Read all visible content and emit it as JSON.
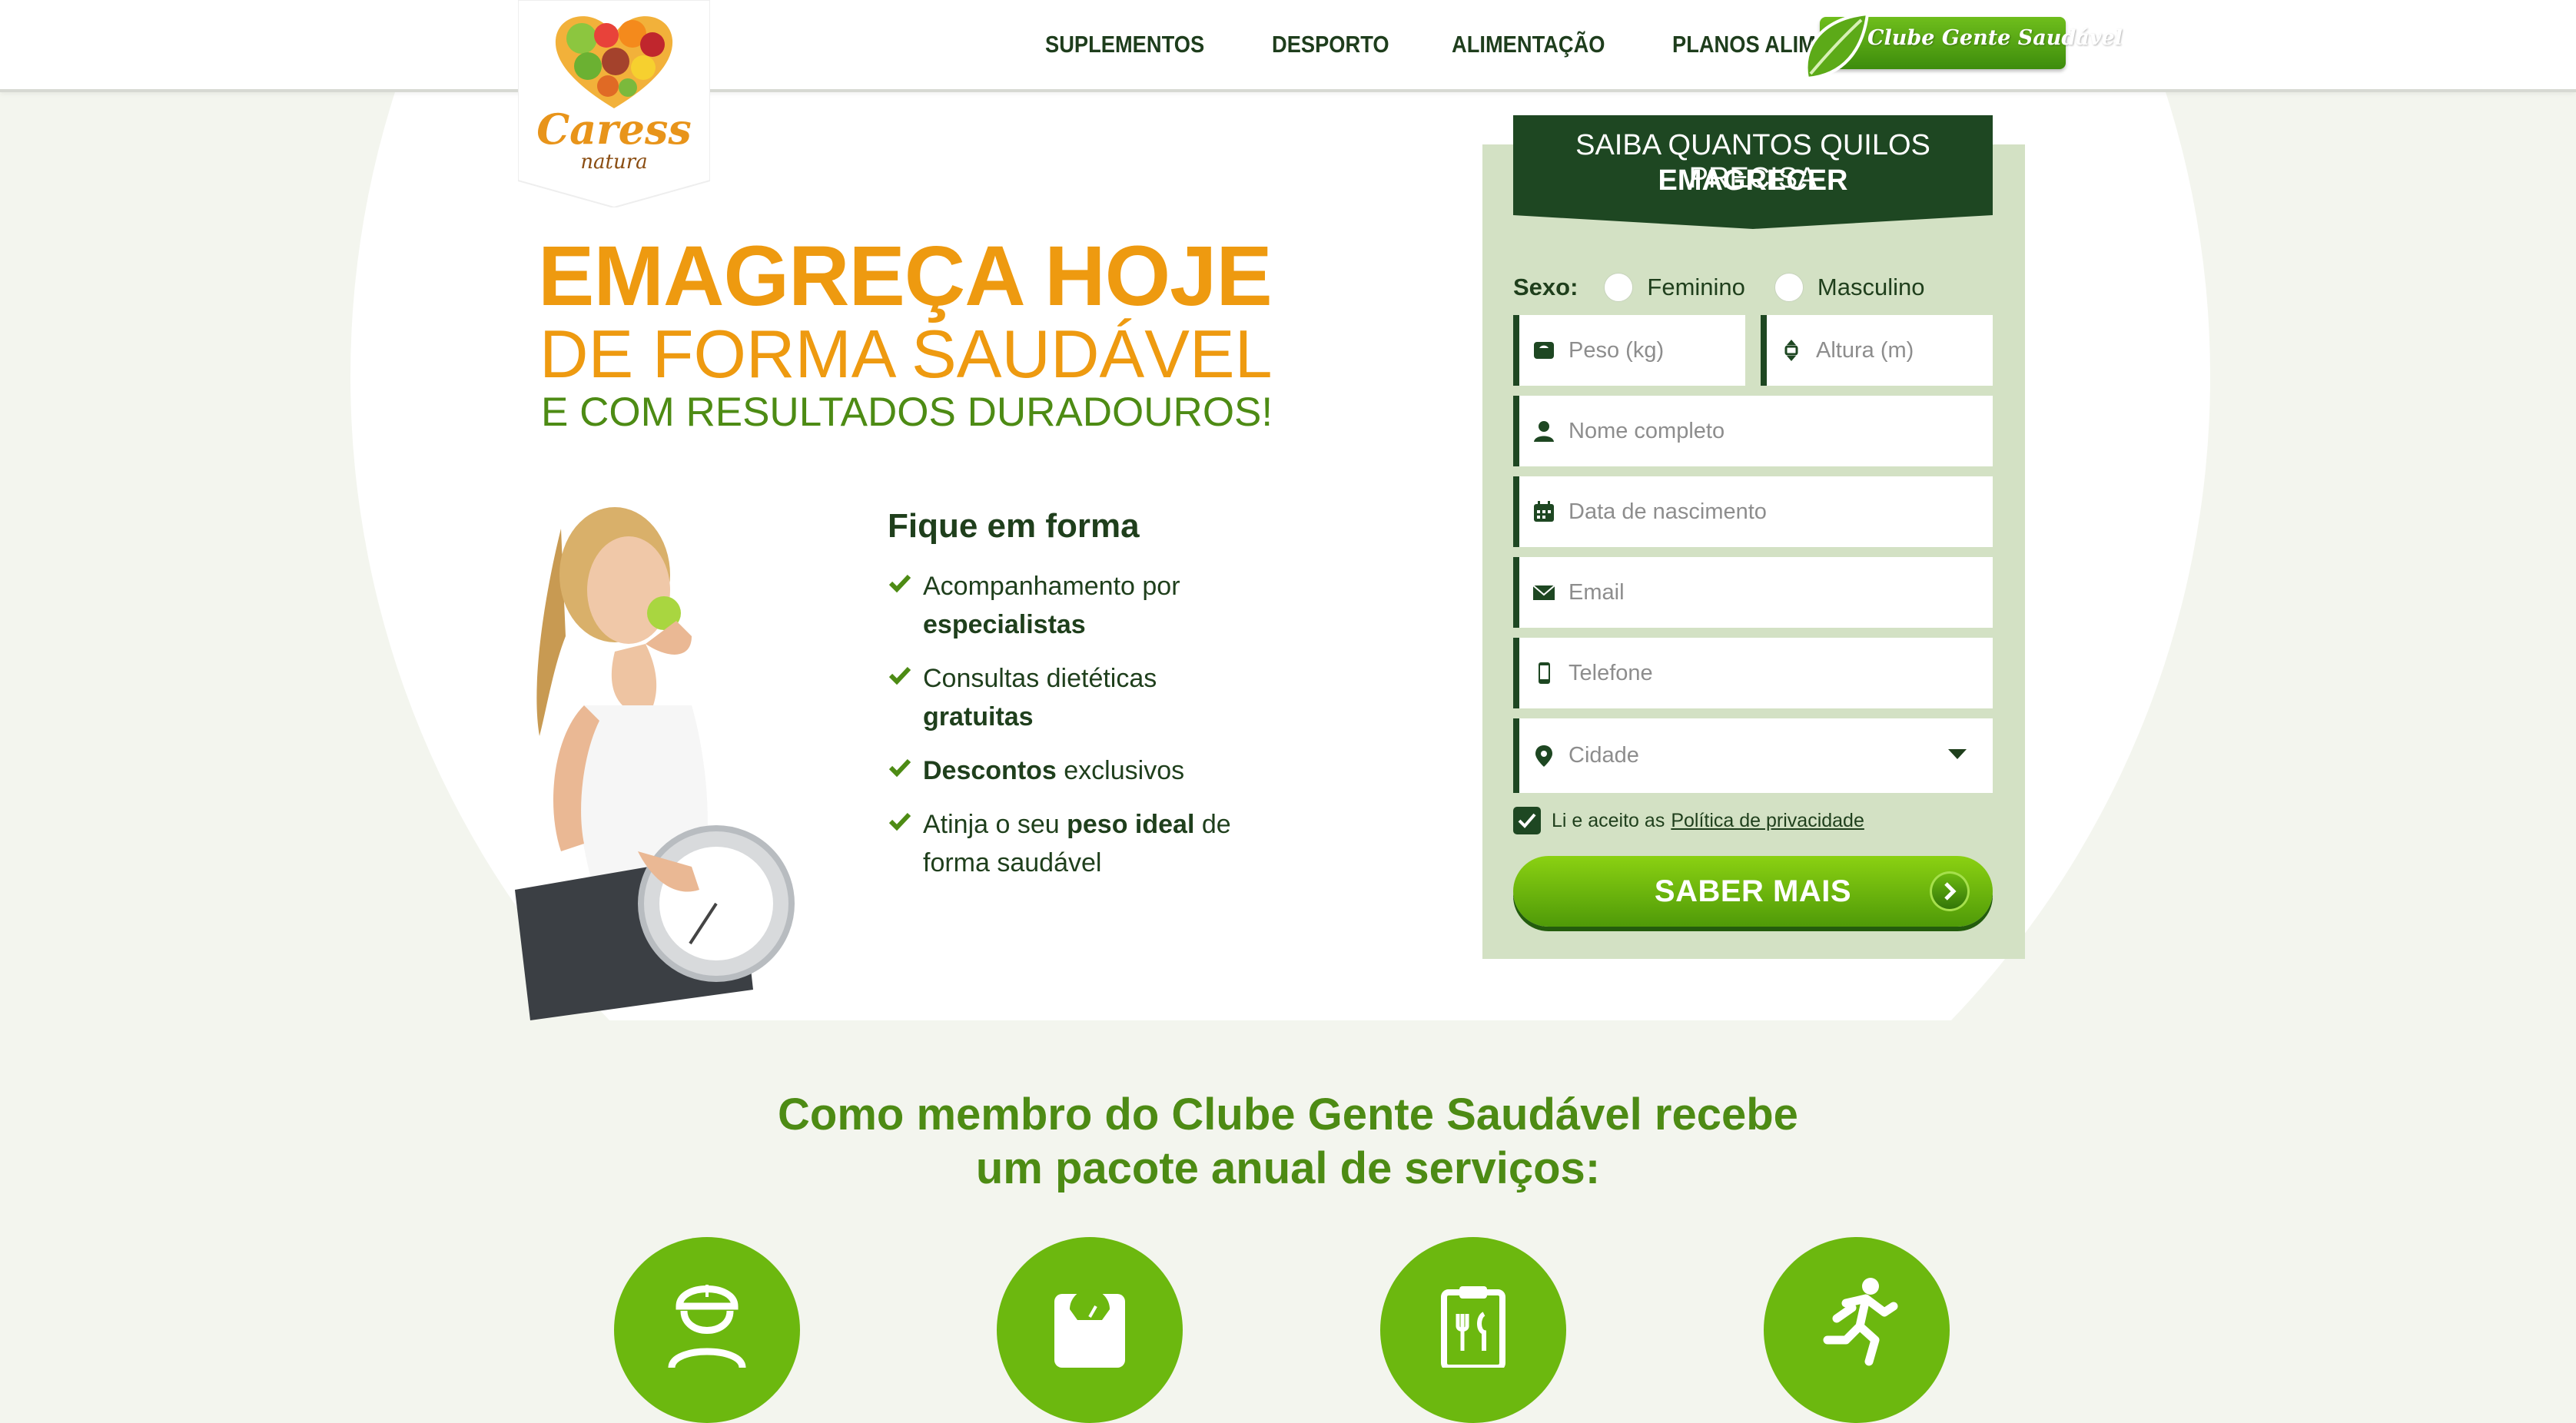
{
  "header": {
    "logo_name": "Caress",
    "logo_sub": "natura",
    "nav": [
      "SUPLEMENTOS",
      "DESPORTO",
      "ALIMENTAÇÃO",
      "PLANOS ALIMENTARES"
    ],
    "clube_badge": "Clube Gente Saudável"
  },
  "hero": {
    "line1": "EMAGREÇA HOJE",
    "line2": "DE FORMA SAUDÁVEL",
    "line3": "E COM RESULTADOS DURADOUROS!",
    "fit_title": "Fique em forma",
    "benefits": [
      {
        "pre": "Acompanhamento por ",
        "bold": "especialistas",
        "post": ""
      },
      {
        "pre": "Consultas dietéticas ",
        "bold": "gratuitas",
        "post": ""
      },
      {
        "pre": "",
        "bold": "Descontos",
        "post": " exclusivos"
      },
      {
        "pre": "Atinja o seu ",
        "bold": "peso ideal",
        "post": " de forma saudável"
      }
    ]
  },
  "form": {
    "head_line1": "SAIBA QUANTOS QUILOS PRECISA",
    "head_line2": "EMAGRECER",
    "sexo_label": "Sexo:",
    "sexo_options": [
      "Feminino",
      "Masculino"
    ],
    "weight_placeholder": "Peso (kg)",
    "height_placeholder": "Altura (m)",
    "name_placeholder": "Nome completo",
    "birth_placeholder": "Data de nascimento",
    "email_placeholder": "Email",
    "phone_placeholder": "Telefone",
    "city_placeholder": "Cidade",
    "privacy_text": "Li e aceito as",
    "privacy_link": "Política de privacidade",
    "privacy_checked": true,
    "submit_label": "SABER MAIS"
  },
  "services": {
    "title_line1": "Como membro do Clube Gente Saudável recebe",
    "title_line2": "um pacote anual de serviços:",
    "icons": [
      "nurse-icon",
      "scale-icon",
      "meal-plan-icon",
      "runner-icon"
    ]
  },
  "colors": {
    "orange": "#ee9a10",
    "green": "#4d8b14",
    "dark_green": "#1e4722",
    "panel": "#d3e1c4"
  }
}
